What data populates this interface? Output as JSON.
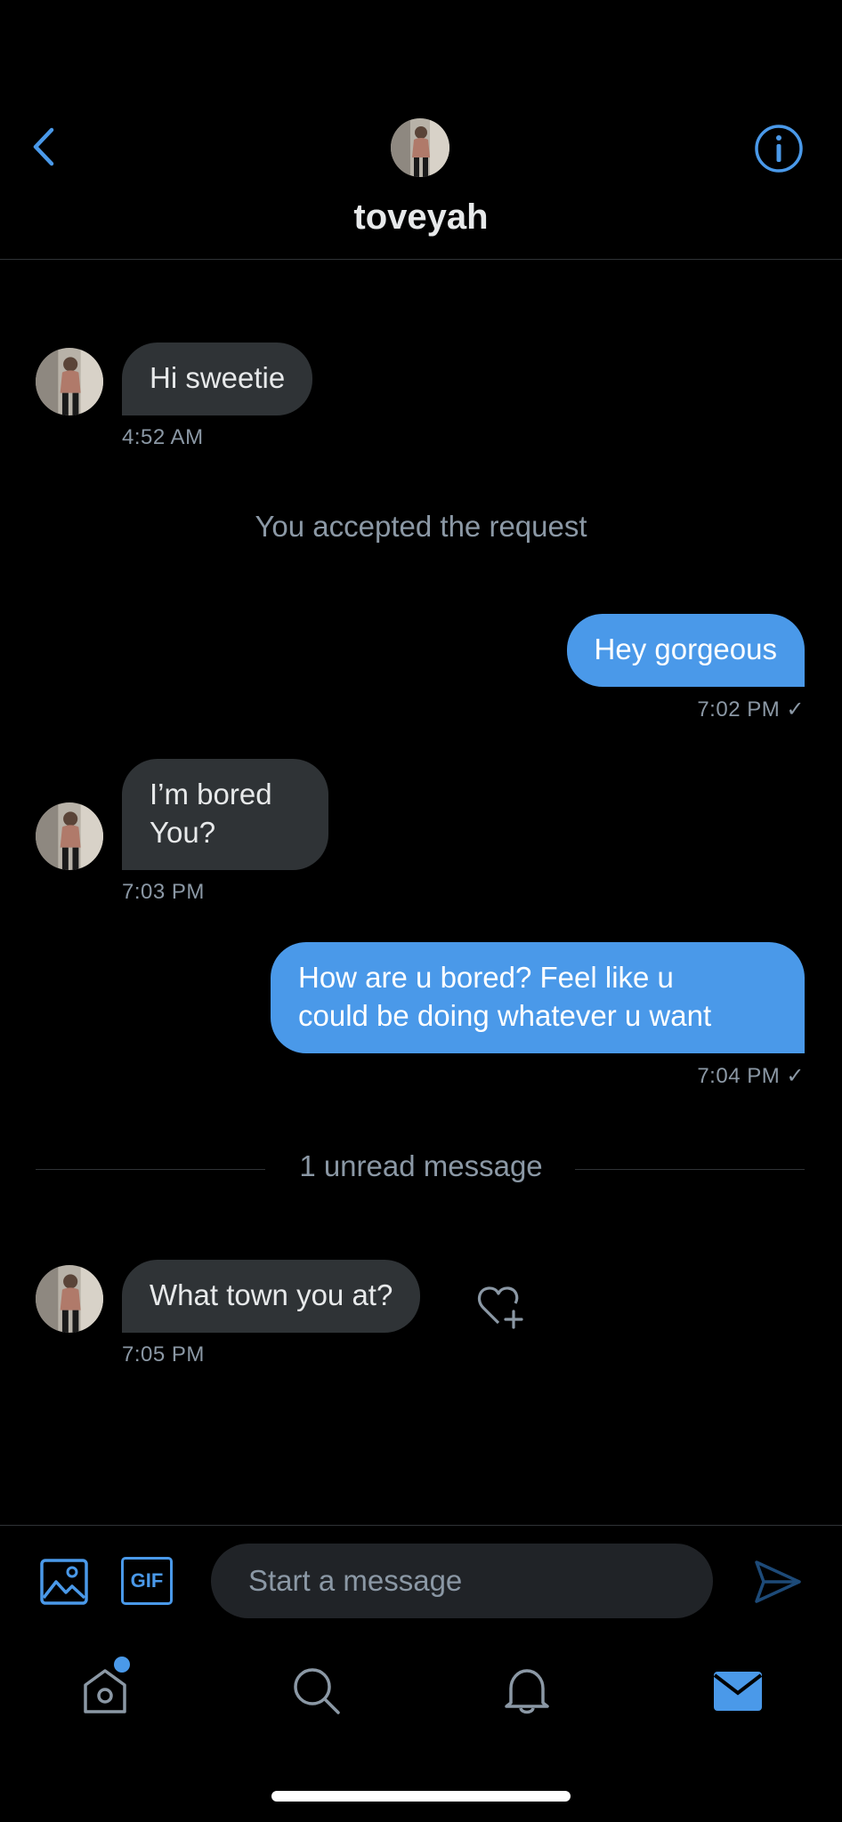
{
  "header": {
    "title": "toveyah",
    "back_icon": "chevron-left-icon",
    "info_icon": "info-icon"
  },
  "messages": [
    {
      "direction": "in",
      "lines": [
        "Hi sweetie"
      ],
      "time": "4:52 AM"
    },
    {
      "direction": "system",
      "text": "You accepted the request"
    },
    {
      "direction": "out",
      "lines": [
        "Hey gorgeous"
      ],
      "time": "7:02 PM"
    },
    {
      "direction": "in",
      "lines": [
        "I’m bored",
        "You?"
      ],
      "time": "7:03 PM"
    },
    {
      "direction": "out",
      "lines": [
        "How are u bored? Feel like u",
        "could be doing whatever u want"
      ],
      "time": "7:04 PM"
    },
    {
      "direction": "divider",
      "text": "1 unread message"
    },
    {
      "direction": "in",
      "lines": [
        "What town you at?"
      ],
      "time": "7:05 PM"
    }
  ],
  "read_check": "✓",
  "composer": {
    "placeholder": "Start a message",
    "gif_label": "GIF",
    "image_icon": "image-icon",
    "send_icon": "send-icon"
  },
  "nav": {
    "items": [
      "home-icon",
      "search-icon",
      "bell-icon",
      "mail-icon"
    ],
    "active": "mail-icon"
  },
  "colors": {
    "accent": "#4a99e9",
    "incoming_bubble": "#2f3336",
    "background": "#000000",
    "muted_text": "#8b98a5"
  }
}
